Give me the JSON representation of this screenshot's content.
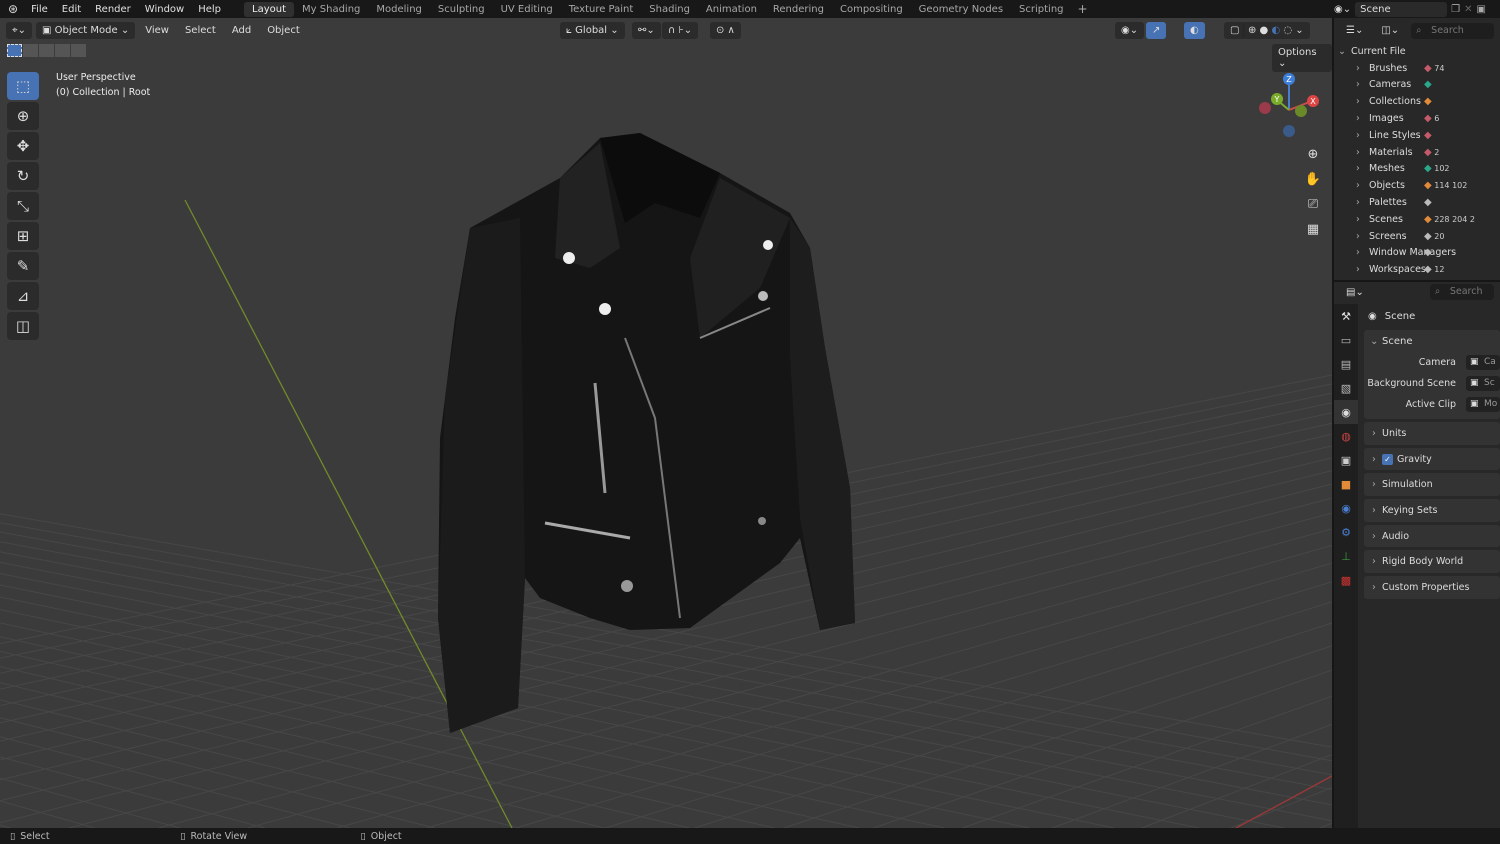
{
  "menus": [
    "File",
    "Edit",
    "Render",
    "Window",
    "Help"
  ],
  "workspaces": [
    "Layout",
    "My Shading",
    "Modeling",
    "Sculpting",
    "UV Editing",
    "Texture Paint",
    "Shading",
    "Animation",
    "Rendering",
    "Compositing",
    "Geometry Nodes",
    "Scripting"
  ],
  "active_workspace": "Layout",
  "scene_name": "Scene",
  "viewport": {
    "mode": "Object Mode",
    "menus": [
      "View",
      "Select",
      "Add",
      "Object"
    ],
    "transform_orientation": "Global",
    "options_label": "Options",
    "perspective": "User Perspective",
    "collection": "(0) Collection | Root",
    "gizmo_axes": [
      "X",
      "Y",
      "Z"
    ]
  },
  "statusbar": {
    "select": "Select",
    "rotate": "Rotate View",
    "object": "Object"
  },
  "outliner": {
    "search_placeholder": "Search",
    "root": "Current File",
    "items": [
      {
        "label": "Brushes",
        "count": "74"
      },
      {
        "label": "Cameras",
        "count": ""
      },
      {
        "label": "Collections",
        "count": ""
      },
      {
        "label": "Images",
        "count": "6"
      },
      {
        "label": "Line Styles",
        "count": ""
      },
      {
        "label": "Materials",
        "count": "2"
      },
      {
        "label": "Meshes",
        "count": "102"
      },
      {
        "label": "Objects",
        "count": "114 102"
      },
      {
        "label": "Palettes",
        "count": ""
      },
      {
        "label": "Scenes",
        "count": "228 204 2"
      },
      {
        "label": "Screens",
        "count": "20"
      },
      {
        "label": "Window Managers",
        "count": ""
      },
      {
        "label": "Workspaces",
        "count": "12"
      }
    ]
  },
  "properties": {
    "search_placeholder": "Search",
    "context": "Scene",
    "panel_title": "Scene",
    "fields": [
      {
        "label": "Camera",
        "value": "Ca"
      },
      {
        "label": "Background Scene",
        "value": "Sc"
      },
      {
        "label": "Active Clip",
        "value": "Mo"
      }
    ],
    "panels": [
      "Units",
      "Gravity",
      "Simulation",
      "Keying Sets",
      "Audio",
      "Rigid Body World",
      "Custom Properties"
    ],
    "gravity_enabled": true
  },
  "colors": {
    "accent": "#4772b3",
    "grid_y_axis": "#7a9a2a",
    "grid_x_axis": "#a03a3a"
  }
}
